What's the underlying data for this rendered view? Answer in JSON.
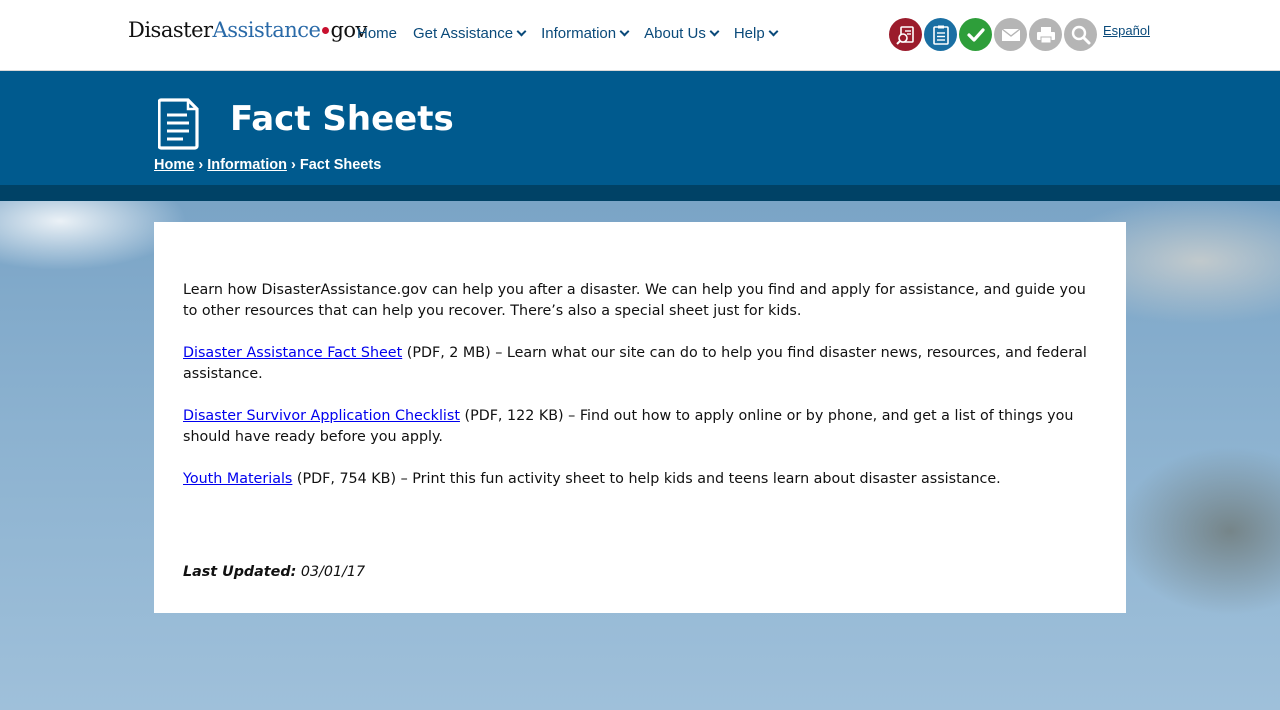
{
  "header": {
    "logo": {
      "part1": "Disaster",
      "part2": "Assistance",
      "part3": "gov"
    },
    "nav": [
      {
        "label": "Home",
        "dropdown": false
      },
      {
        "label": "Get Assistance",
        "dropdown": true
      },
      {
        "label": "Information",
        "dropdown": true
      },
      {
        "label": "About Us",
        "dropdown": true
      },
      {
        "label": "Help",
        "dropdown": true
      }
    ],
    "tools": [
      {
        "icon": "address-lookup-icon",
        "color": "#9b1c2c"
      },
      {
        "icon": "clipboard-checklist-icon",
        "color": "#1a6fa3"
      },
      {
        "icon": "check-status-icon",
        "color": "#2e9e3a"
      },
      {
        "icon": "email-icon",
        "color": "#b5b5b5"
      },
      {
        "icon": "print-icon",
        "color": "#b5b5b5"
      },
      {
        "icon": "search-icon",
        "color": "#b5b5b5"
      }
    ],
    "language_link": "Español"
  },
  "banner": {
    "title": "Fact Sheets",
    "breadcrumb": {
      "home": "Home",
      "separator": "›",
      "information": "Information",
      "current": "Fact Sheets"
    }
  },
  "main": {
    "intro": "Learn how DisasterAssistance.gov can help you after a disaster. We can help you find and apply for assistance, and guide you to other resources that can help you recover. There’s also a special sheet just for kids.",
    "items": [
      {
        "link": "Disaster Assistance Fact Sheet",
        "rest": " (PDF, 2 MB) – Learn what our site can do to help you find disaster news, resources, and federal assistance."
      },
      {
        "link": "Disaster Survivor Application Checklist",
        "rest": " (PDF, 122 KB) – Find out how to apply online or by phone, and get a list of things you should have ready before you apply."
      },
      {
        "link": "Youth Materials",
        "rest": " (PDF, 754 KB) – Print this fun activity sheet to help kids and teens learn about disaster assistance."
      }
    ],
    "last_updated_label": "Last Updated:",
    "last_updated_value": " 03/01/17"
  },
  "colors": {
    "banner": "#005a8e",
    "banner_bottom": "#004266",
    "nav_text": "#0a4a7a",
    "link": "#0000ee"
  }
}
